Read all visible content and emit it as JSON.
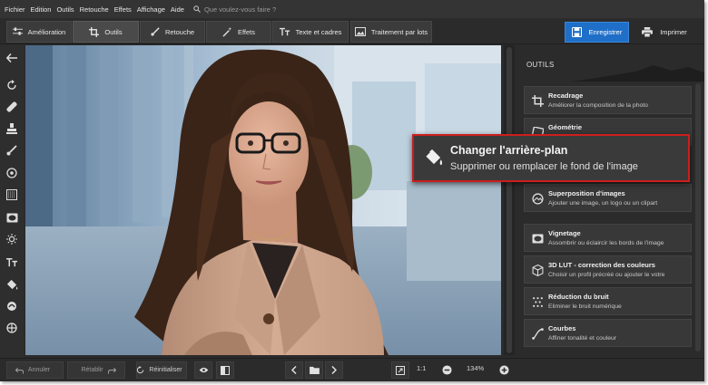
{
  "menu": {
    "items": [
      "Fichier",
      "Edition",
      "Outils",
      "Retouche",
      "Effets",
      "Affichage",
      "Aide"
    ],
    "search_placeholder": "Que voulez-vous faire ?"
  },
  "tabs": [
    {
      "label": "Amélioration",
      "icon": "sliders-icon",
      "active": false
    },
    {
      "label": "Outils",
      "icon": "crop-icon",
      "active": true
    },
    {
      "label": "Retouche",
      "icon": "brush-icon",
      "active": false
    },
    {
      "label": "Effets",
      "icon": "magic-wand-icon",
      "active": false
    },
    {
      "label": "Texte et cadres",
      "icon": "text-icon",
      "active": false
    },
    {
      "label": "Traitement par lots",
      "icon": "batch-image-icon",
      "active": false
    }
  ],
  "actions": {
    "save": "Enregistrer",
    "print": "Imprimer"
  },
  "colors": {
    "accent": "#1f6fc8",
    "highlight": "#cc1e1e",
    "panel": "#2b2b2b"
  },
  "panel": {
    "title": "OUTILS",
    "cards": [
      {
        "title": "Recadrage",
        "subtitle": "Améliorer la composition de la photo",
        "icon": "crop-icon"
      },
      {
        "title": "Géométrie",
        "subtitle": "",
        "icon": "geometry-icon"
      },
      {
        "title": "Superposition d'images",
        "subtitle": "Ajouter une image, un logo ou un clipart",
        "icon": "overlay-icon"
      },
      {
        "title": "Vignetage",
        "subtitle": "Assombrir ou éclaircir les bords de l'image",
        "icon": "vignette-icon"
      },
      {
        "title": "3D LUT - correction des couleurs",
        "subtitle": "Choisir un profil précréé ou ajouter le votre",
        "icon": "lut-cube-icon"
      },
      {
        "title": "Réduction du bruit",
        "subtitle": "Eliminer le bruit numérique",
        "icon": "noise-icon"
      },
      {
        "title": "Courbes",
        "subtitle": "Affiner tonalité et couleur",
        "icon": "curves-icon"
      }
    ]
  },
  "callout": {
    "title": "Changer l'arrière-plan",
    "subtitle": "Supprimer ou remplacer le fond de l'image",
    "icon": "paint-bucket-icon"
  },
  "bottom": {
    "undo": "Annuler",
    "redo": "Rétablir",
    "reset": "Réinitialiser",
    "ratio": "1:1",
    "zoom": "134%"
  }
}
